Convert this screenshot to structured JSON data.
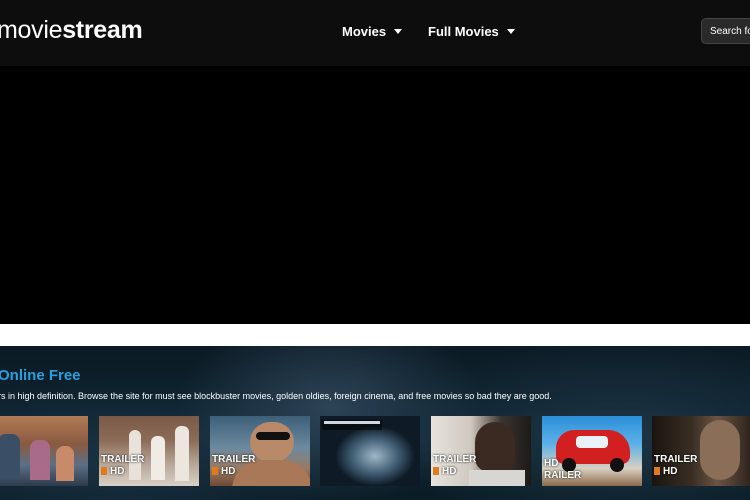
{
  "header": {
    "logo_light": "movie",
    "logo_bold": "stream",
    "nav": [
      {
        "label": "Movies"
      },
      {
        "label": "Full Movies"
      }
    ],
    "search_placeholder": "Search fo"
  },
  "section": {
    "title": "Online Free",
    "description": "rs in high definition. Browse the site for must see blockbuster movies, golden oldies, foreign cinema, and free movies so bad they are good."
  },
  "thumbnails": [
    {
      "tag_top": "",
      "tag_bottom": ""
    },
    {
      "tag_top": "TRAILER",
      "tag_bottom": "HD"
    },
    {
      "tag_top": "TRAILER",
      "tag_bottom": "HD"
    },
    {
      "tag_top": "",
      "tag_bottom": ""
    },
    {
      "tag_top": "TRAILER",
      "tag_bottom": "HD"
    },
    {
      "tag_top": "HD",
      "tag_bottom": "RAILER"
    },
    {
      "tag_top": "TRAILER",
      "tag_bottom": "HD"
    }
  ],
  "colors": {
    "accent": "#2a9fe0",
    "header_bg": "#0d0d0d",
    "badge": "#e07a1f"
  }
}
